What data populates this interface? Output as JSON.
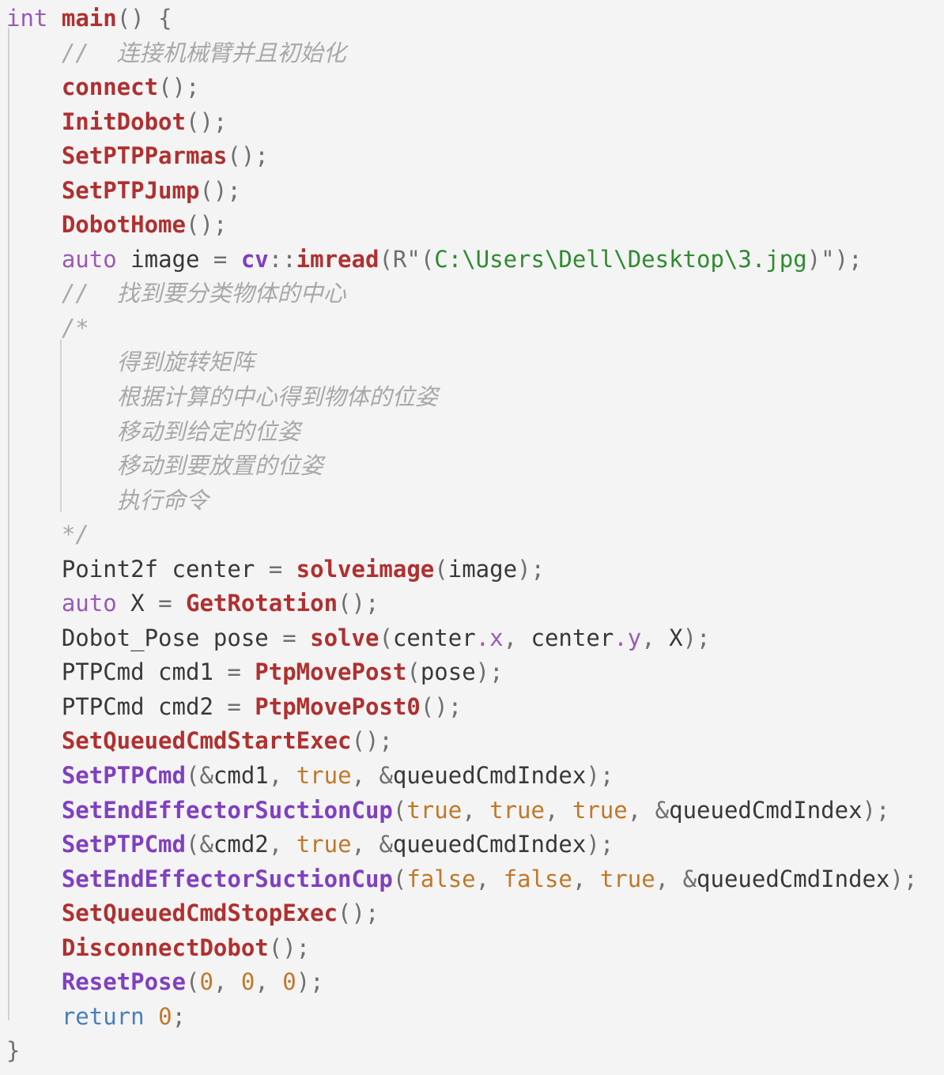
{
  "editor": {
    "language": "C++",
    "background_color": "#f4f4f4",
    "font_size_px": 29,
    "line_height_px": 43.55,
    "theme_colors": {
      "keyword": "#9b59b6",
      "return_keyword": "#4a7ebb",
      "function_call": "#b03030",
      "function_call_alt": "#8040c0",
      "string": "#2e8b2e",
      "number": "#c07828",
      "boolean": "#c07828",
      "comment": "#a8a8a8",
      "punctuation": "#707070",
      "identifier": "#383838",
      "indent_guide": "#d2d2d2"
    }
  },
  "code": {
    "line_01": {
      "kw_int": "int",
      "fn_main": "main",
      "parens": "()",
      "brace": " {"
    },
    "line_02": {
      "comment": "//  连接机械臂并且初始化"
    },
    "line_03": {
      "fn": "connect",
      "tail": "();"
    },
    "line_04": {
      "fn": "InitDobot",
      "tail": "();"
    },
    "line_05": {
      "fn": "SetPTPParmas",
      "tail": "();"
    },
    "line_06": {
      "fn": "SetPTPJump",
      "tail": "();"
    },
    "line_07": {
      "fn": "DobotHome",
      "tail": "();"
    },
    "line_08": {
      "kw": "auto",
      "var": " image ",
      "eq": "= ",
      "ns": "cv",
      "scope": "::",
      "fn": "imread",
      "open": "(R\"(",
      "str": "C:\\Users\\Dell\\Desktop\\3.jpg",
      "close": ")\");"
    },
    "line_09": {
      "comment": "//  找到要分类物体的中心"
    },
    "line_10": {
      "comment": "/*"
    },
    "line_11": {
      "comment": "得到旋转矩阵"
    },
    "line_12": {
      "comment": "根据计算的中心得到物体的位姿"
    },
    "line_13": {
      "comment": "移动到给定的位姿"
    },
    "line_14": {
      "comment": "移动到要放置的位姿"
    },
    "line_15": {
      "comment": "执行命令"
    },
    "line_16": {
      "comment": "*/"
    },
    "line_17": {
      "type": "Point2f center ",
      "eq": "= ",
      "fn": "solveimage",
      "open": "(",
      "arg": "image",
      "close": ");"
    },
    "line_18": {
      "kw": "auto",
      "var": " X ",
      "eq": "= ",
      "fn": "GetRotation",
      "tail": "();"
    },
    "line_19": {
      "type": "Dobot_Pose pose ",
      "eq": "= ",
      "fn": "solve",
      "open": "(",
      "a1": "center",
      "m1": ".x",
      "sep1": ", ",
      "a2": "center",
      "m2": ".y",
      "sep2": ", ",
      "a3": "X",
      "close": ");"
    },
    "line_20": {
      "type": "PTPCmd cmd1 ",
      "eq": "= ",
      "fn": "PtpMovePost",
      "open": "(",
      "arg": "pose",
      "close": ");"
    },
    "line_21": {
      "type": "PTPCmd cmd2 ",
      "eq": "= ",
      "fn": "PtpMovePost0",
      "tail": "();"
    },
    "line_22": {
      "fn": "SetQueuedCmdStartExec",
      "tail": "();"
    },
    "line_23": {
      "fn": "SetPTPCmd",
      "open": "(",
      "amp": "&",
      "a1": "cmd1",
      "sep1": ", ",
      "b1": "true",
      "sep2": ", ",
      "amp2": "&",
      "a2": "queuedCmdIndex",
      "close": ");"
    },
    "line_24": {
      "fn": "SetEndEffectorSuctionCup",
      "open": "(",
      "b1": "true",
      "sep1": ", ",
      "b2": "true",
      "sep2": ", ",
      "b3": "true",
      "sep3": ", ",
      "amp": "&",
      "arg": "queuedCmdIndex",
      "close": ");"
    },
    "line_25": {
      "fn": "SetPTPCmd",
      "open": "(",
      "amp": "&",
      "a1": "cmd2",
      "sep1": ", ",
      "b1": "true",
      "sep2": ", ",
      "amp2": "&",
      "a2": "queuedCmdIndex",
      "close": ");"
    },
    "line_26": {
      "fn": "SetEndEffectorSuctionCup",
      "open": "(",
      "b1": "false",
      "sep1": ", ",
      "b2": "false",
      "sep2": ", ",
      "b3": "true",
      "sep3": ", ",
      "amp": "&",
      "arg": "queuedCmdIndex",
      "close": ");"
    },
    "line_27": {
      "fn": "SetQueuedCmdStopExec",
      "tail": "();"
    },
    "line_28": {
      "fn": "DisconnectDobot",
      "tail": "();"
    },
    "line_29": {
      "fn": "ResetPose",
      "open": "(",
      "n1": "0",
      "sep1": ", ",
      "n2": "0",
      "sep2": ", ",
      "n3": "0",
      "close": ");"
    },
    "line_30": {
      "kw": "return",
      "space": " ",
      "num": "0",
      "semi": ";"
    },
    "line_31": {
      "brace": "}"
    }
  }
}
